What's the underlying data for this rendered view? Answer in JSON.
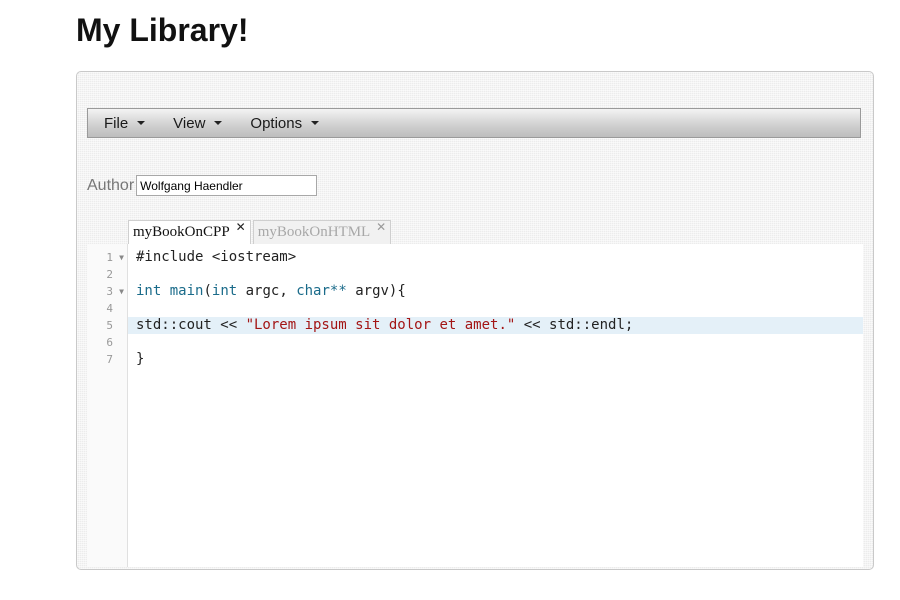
{
  "page": {
    "title": "My Library!"
  },
  "menubar": {
    "items": [
      {
        "label": "File"
      },
      {
        "label": "View"
      },
      {
        "label": "Options"
      }
    ]
  },
  "author": {
    "label": "Author",
    "value": "Wolfgang Haendler"
  },
  "tabs": [
    {
      "label": "myBookOnCPP",
      "active": true,
      "close": "✕"
    },
    {
      "label": "myBookOnHTML",
      "active": false,
      "close": "✕"
    }
  ],
  "editor": {
    "current_line": 5,
    "lines": [
      {
        "number": "1",
        "fold": "▼",
        "tokens": [
          {
            "t": "#include <iostream>"
          }
        ]
      },
      {
        "number": "2",
        "fold": "",
        "tokens": []
      },
      {
        "number": "3",
        "fold": "▼",
        "tokens": [
          {
            "t": "int",
            "c": "kw"
          },
          {
            "t": " "
          },
          {
            "t": "main",
            "c": "kw"
          },
          {
            "t": "("
          },
          {
            "t": "int",
            "c": "kw"
          },
          {
            "t": " argc, "
          },
          {
            "t": "char**",
            "c": "kw"
          },
          {
            "t": " argv){"
          }
        ]
      },
      {
        "number": "4",
        "fold": "",
        "tokens": []
      },
      {
        "number": "5",
        "fold": "",
        "tokens": [
          {
            "t": "std::cout << "
          },
          {
            "t": "\"Lorem ipsum sit dolor et amet.\"",
            "c": "str"
          },
          {
            "t": " << std::endl;"
          }
        ]
      },
      {
        "number": "6",
        "fold": "",
        "tokens": []
      },
      {
        "number": "7",
        "fold": "",
        "tokens": [
          {
            "t": "}"
          }
        ]
      }
    ]
  }
}
